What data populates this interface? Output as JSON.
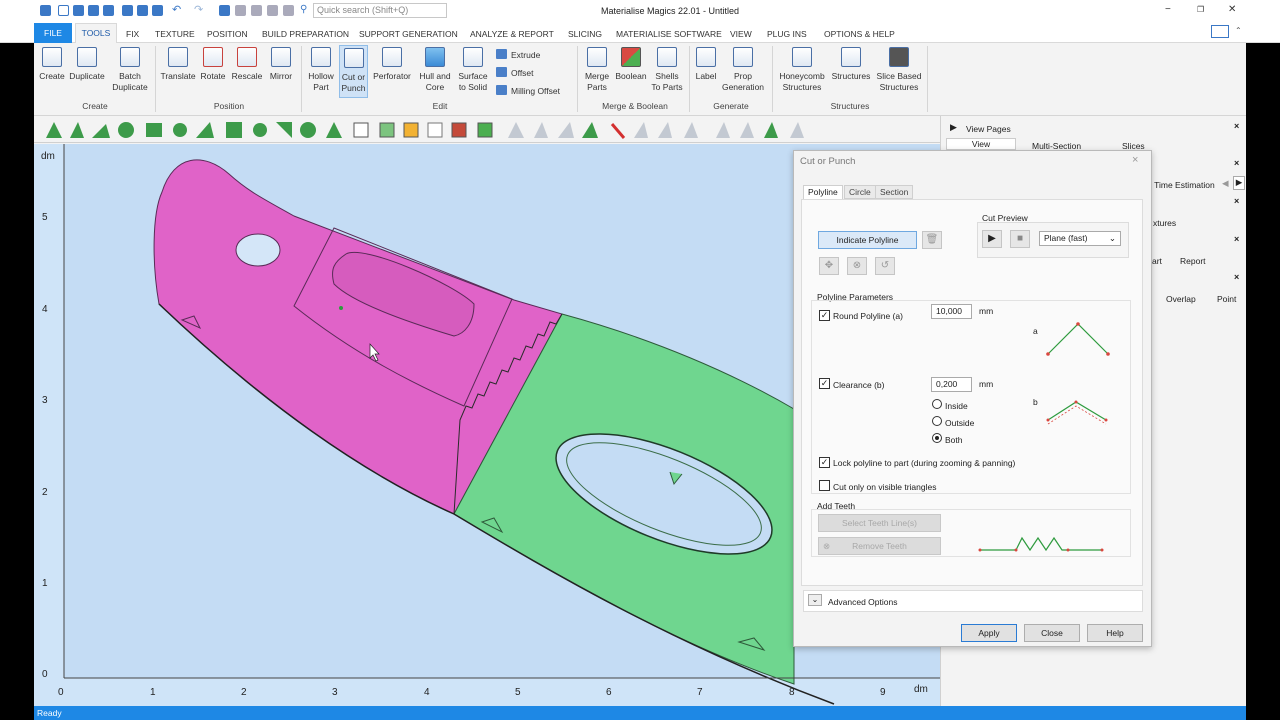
{
  "window": {
    "title": "Materialise Magics 22.01 - Untitled",
    "search_placeholder": "Quick search (Shift+Q)"
  },
  "menu": [
    "FILE",
    "TOOLS",
    "FIX",
    "TEXTURE",
    "POSITION",
    "BUILD PREPARATION",
    "SUPPORT GENERATION",
    "ANALYZE & REPORT",
    "SLICING",
    "MATERIALISE SOFTWARE",
    "VIEW",
    "PLUG INS",
    "OPTIONS & HELP"
  ],
  "ribbon": {
    "create": [
      "Create",
      "Duplicate",
      "Batch\nDuplicate"
    ],
    "create_label": "Create",
    "position": [
      "Translate",
      "Rotate",
      "Rescale",
      "Mirror"
    ],
    "position_label": "Position",
    "edit": [
      "Hollow\nPart",
      "Cut or\nPunch",
      "Perforator",
      "Hull and\nCore",
      "Surface\nto Solid"
    ],
    "edit_small": [
      "Extrude",
      "Offset",
      "Milling Offset"
    ],
    "edit_label": "Edit",
    "merge": [
      "Merge\nParts",
      "Boolean",
      "Shells\nTo Parts"
    ],
    "merge_label": "Merge & Boolean",
    "generate": [
      "Label",
      "Prop\nGeneration"
    ],
    "generate_label": "Generate",
    "structures": [
      "Honeycomb\nStructures",
      "Structures",
      "Slice Based\nStructures"
    ],
    "structures_label": "Structures"
  },
  "viewport": {
    "unit_y": "dm",
    "unit_x": "dm",
    "y_ticks": [
      "5",
      "4",
      "3",
      "2",
      "1",
      "0"
    ],
    "x_ticks": [
      "0",
      "1",
      "2",
      "3",
      "4",
      "5",
      "6",
      "7",
      "8",
      "9"
    ]
  },
  "right_panel": {
    "view_pages": "View Pages",
    "view": "View",
    "multi_section": "Multi-Section",
    "slices": "Slices",
    "time_estimation": "l Time Estimation",
    "xtures": "xtures",
    "art": "art",
    "report": "Report",
    "overlap": "Overlap",
    "point": "Point"
  },
  "dialog": {
    "title": "Cut or Punch",
    "tabs": [
      "Polyline",
      "Circle",
      "Section"
    ],
    "indicate_polyline": "Indicate Polyline",
    "cut_preview_label": "Cut Preview",
    "preview_mode": "Plane (fast)",
    "polyline_params_label": "Polyline Parameters",
    "round_polyline_label": "Round Polyline (a)",
    "round_polyline_value": "10,000",
    "clearance_label": "Clearance (b)",
    "clearance_value": "0,200",
    "unit": "mm",
    "radio_inside": "Inside",
    "radio_outside": "Outside",
    "radio_both": "Both",
    "diagram_a": "a",
    "diagram_b": "b",
    "lock_polyline_label": "Lock polyline to part (during zooming & panning)",
    "cut_visible_label": "Cut only on visible triangles",
    "add_teeth_label": "Add Teeth",
    "select_teeth": "Select Teeth Line(s)",
    "remove_teeth": "Remove Teeth",
    "advanced_options": "Advanced Options",
    "apply": "Apply",
    "close": "Close",
    "help": "Help"
  },
  "status": "Ready",
  "colors": {
    "accent": "#1e88e5",
    "part_magenta": "#e063c8",
    "part_green": "#6fd68f",
    "viewport_bg": "#cfe4f8"
  }
}
